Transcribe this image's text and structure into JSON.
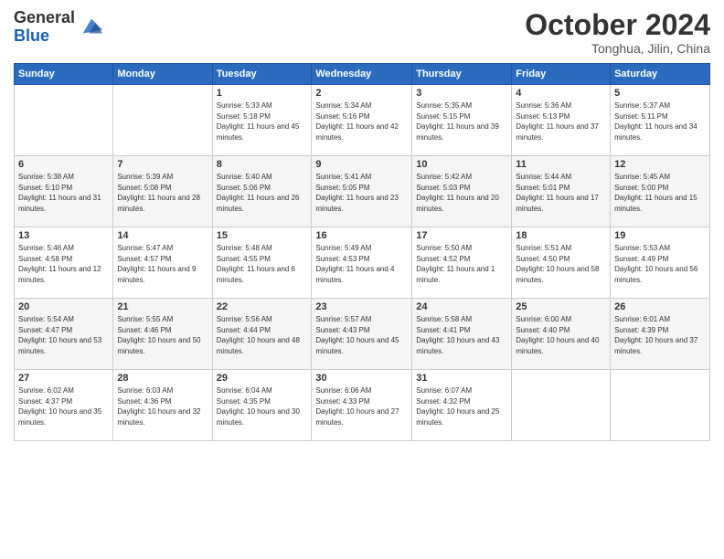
{
  "header": {
    "logo_general": "General",
    "logo_blue": "Blue",
    "title": "October 2024",
    "location": "Tonghua, Jilin, China"
  },
  "calendar": {
    "days_of_week": [
      "Sunday",
      "Monday",
      "Tuesday",
      "Wednesday",
      "Thursday",
      "Friday",
      "Saturday"
    ],
    "weeks": [
      [
        {
          "day": "",
          "detail": ""
        },
        {
          "day": "",
          "detail": ""
        },
        {
          "day": "1",
          "detail": "Sunrise: 5:33 AM\nSunset: 5:18 PM\nDaylight: 11 hours and 45 minutes."
        },
        {
          "day": "2",
          "detail": "Sunrise: 5:34 AM\nSunset: 5:16 PM\nDaylight: 11 hours and 42 minutes."
        },
        {
          "day": "3",
          "detail": "Sunrise: 5:35 AM\nSunset: 5:15 PM\nDaylight: 11 hours and 39 minutes."
        },
        {
          "day": "4",
          "detail": "Sunrise: 5:36 AM\nSunset: 5:13 PM\nDaylight: 11 hours and 37 minutes."
        },
        {
          "day": "5",
          "detail": "Sunrise: 5:37 AM\nSunset: 5:11 PM\nDaylight: 11 hours and 34 minutes."
        }
      ],
      [
        {
          "day": "6",
          "detail": "Sunrise: 5:38 AM\nSunset: 5:10 PM\nDaylight: 11 hours and 31 minutes."
        },
        {
          "day": "7",
          "detail": "Sunrise: 5:39 AM\nSunset: 5:08 PM\nDaylight: 11 hours and 28 minutes."
        },
        {
          "day": "8",
          "detail": "Sunrise: 5:40 AM\nSunset: 5:06 PM\nDaylight: 11 hours and 26 minutes."
        },
        {
          "day": "9",
          "detail": "Sunrise: 5:41 AM\nSunset: 5:05 PM\nDaylight: 11 hours and 23 minutes."
        },
        {
          "day": "10",
          "detail": "Sunrise: 5:42 AM\nSunset: 5:03 PM\nDaylight: 11 hours and 20 minutes."
        },
        {
          "day": "11",
          "detail": "Sunrise: 5:44 AM\nSunset: 5:01 PM\nDaylight: 11 hours and 17 minutes."
        },
        {
          "day": "12",
          "detail": "Sunrise: 5:45 AM\nSunset: 5:00 PM\nDaylight: 11 hours and 15 minutes."
        }
      ],
      [
        {
          "day": "13",
          "detail": "Sunrise: 5:46 AM\nSunset: 4:58 PM\nDaylight: 11 hours and 12 minutes."
        },
        {
          "day": "14",
          "detail": "Sunrise: 5:47 AM\nSunset: 4:57 PM\nDaylight: 11 hours and 9 minutes."
        },
        {
          "day": "15",
          "detail": "Sunrise: 5:48 AM\nSunset: 4:55 PM\nDaylight: 11 hours and 6 minutes."
        },
        {
          "day": "16",
          "detail": "Sunrise: 5:49 AM\nSunset: 4:53 PM\nDaylight: 11 hours and 4 minutes."
        },
        {
          "day": "17",
          "detail": "Sunrise: 5:50 AM\nSunset: 4:52 PM\nDaylight: 11 hours and 1 minute."
        },
        {
          "day": "18",
          "detail": "Sunrise: 5:51 AM\nSunset: 4:50 PM\nDaylight: 10 hours and 58 minutes."
        },
        {
          "day": "19",
          "detail": "Sunrise: 5:53 AM\nSunset: 4:49 PM\nDaylight: 10 hours and 56 minutes."
        }
      ],
      [
        {
          "day": "20",
          "detail": "Sunrise: 5:54 AM\nSunset: 4:47 PM\nDaylight: 10 hours and 53 minutes."
        },
        {
          "day": "21",
          "detail": "Sunrise: 5:55 AM\nSunset: 4:46 PM\nDaylight: 10 hours and 50 minutes."
        },
        {
          "day": "22",
          "detail": "Sunrise: 5:56 AM\nSunset: 4:44 PM\nDaylight: 10 hours and 48 minutes."
        },
        {
          "day": "23",
          "detail": "Sunrise: 5:57 AM\nSunset: 4:43 PM\nDaylight: 10 hours and 45 minutes."
        },
        {
          "day": "24",
          "detail": "Sunrise: 5:58 AM\nSunset: 4:41 PM\nDaylight: 10 hours and 43 minutes."
        },
        {
          "day": "25",
          "detail": "Sunrise: 6:00 AM\nSunset: 4:40 PM\nDaylight: 10 hours and 40 minutes."
        },
        {
          "day": "26",
          "detail": "Sunrise: 6:01 AM\nSunset: 4:39 PM\nDaylight: 10 hours and 37 minutes."
        }
      ],
      [
        {
          "day": "27",
          "detail": "Sunrise: 6:02 AM\nSunset: 4:37 PM\nDaylight: 10 hours and 35 minutes."
        },
        {
          "day": "28",
          "detail": "Sunrise: 6:03 AM\nSunset: 4:36 PM\nDaylight: 10 hours and 32 minutes."
        },
        {
          "day": "29",
          "detail": "Sunrise: 6:04 AM\nSunset: 4:35 PM\nDaylight: 10 hours and 30 minutes."
        },
        {
          "day": "30",
          "detail": "Sunrise: 6:06 AM\nSunset: 4:33 PM\nDaylight: 10 hours and 27 minutes."
        },
        {
          "day": "31",
          "detail": "Sunrise: 6:07 AM\nSunset: 4:32 PM\nDaylight: 10 hours and 25 minutes."
        },
        {
          "day": "",
          "detail": ""
        },
        {
          "day": "",
          "detail": ""
        }
      ]
    ]
  }
}
